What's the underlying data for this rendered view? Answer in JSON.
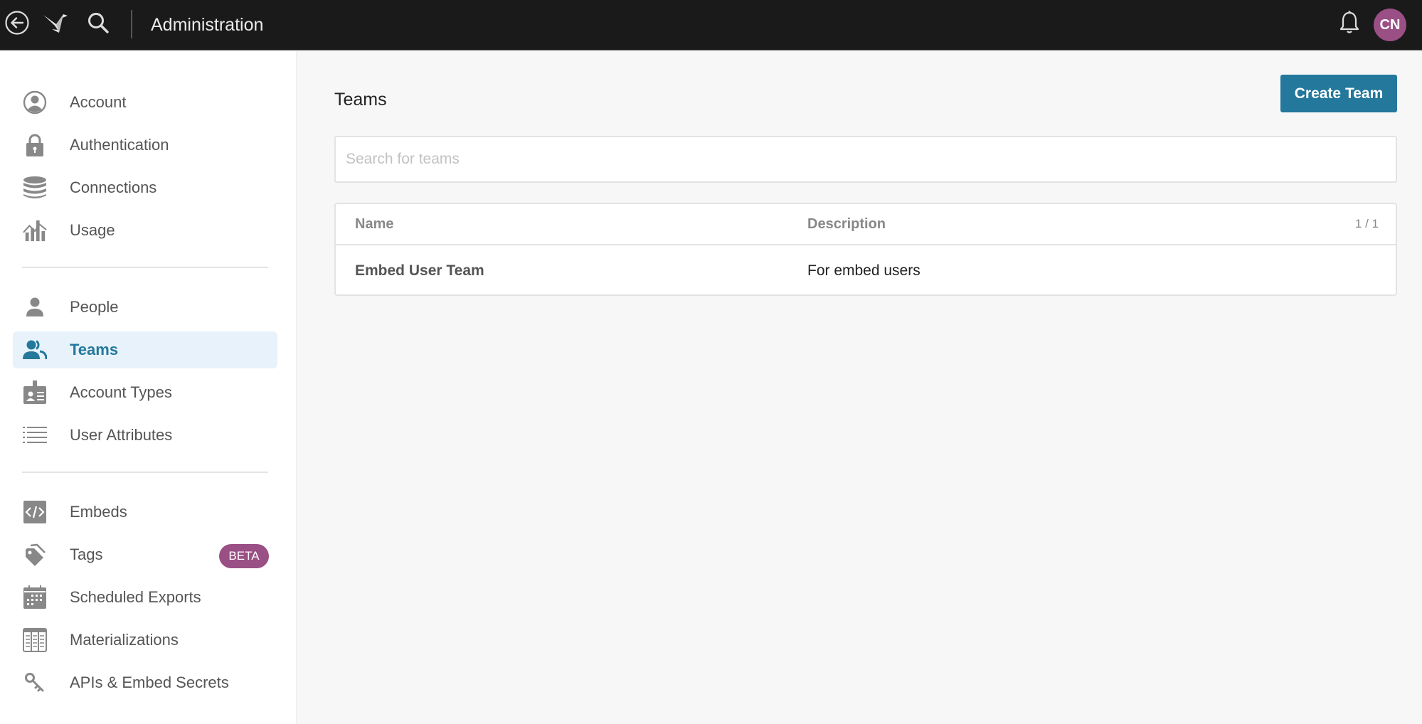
{
  "topbar": {
    "title": "Administration",
    "icons": {
      "back": "back-arrow-circle-icon",
      "logo": "bird-logo-icon",
      "search": "search-icon",
      "notifications": "bell-icon"
    },
    "avatar_initials": "CN"
  },
  "sidebar": {
    "groups": [
      {
        "items": [
          {
            "label": "Account",
            "icon": "account-circle-icon"
          },
          {
            "label": "Authentication",
            "icon": "lock-icon"
          },
          {
            "label": "Connections",
            "icon": "database-icon"
          },
          {
            "label": "Usage",
            "icon": "usage-chart-icon"
          }
        ]
      },
      {
        "items": [
          {
            "label": "People",
            "icon": "person-icon"
          },
          {
            "label": "Teams",
            "icon": "team-icon",
            "active": true
          },
          {
            "label": "Account Types",
            "icon": "id-badge-icon"
          },
          {
            "label": "User Attributes",
            "icon": "list-icon"
          }
        ]
      },
      {
        "items": [
          {
            "label": "Embeds",
            "icon": "code-icon"
          },
          {
            "label": "Tags",
            "icon": "tags-icon",
            "badge": "BETA"
          },
          {
            "label": "Scheduled Exports",
            "icon": "calendar-icon"
          },
          {
            "label": "Materializations",
            "icon": "table-grid-icon"
          },
          {
            "label": "APIs & Embed Secrets",
            "icon": "key-icon"
          }
        ]
      }
    ]
  },
  "main": {
    "title": "Teams",
    "create_button": "Create Team",
    "search": {
      "placeholder": "Search for teams",
      "value": ""
    },
    "table": {
      "columns": [
        "Name",
        "Description"
      ],
      "page_count": "1 / 1",
      "rows": [
        {
          "name": "Embed User Team",
          "description": "For embed users"
        }
      ]
    }
  },
  "colors": {
    "accent": "#23789c",
    "active_bg": "#e8f2fa",
    "badge": "#9a4f85",
    "topbar": "#1a1a1a"
  }
}
